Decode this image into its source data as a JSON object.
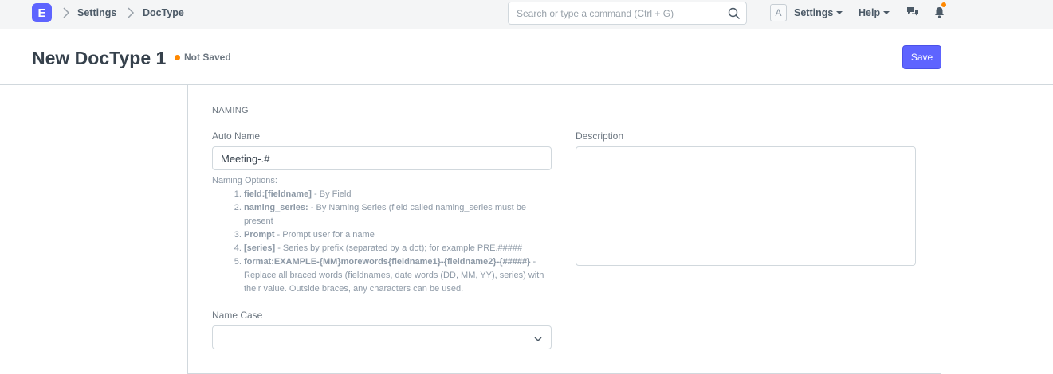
{
  "navbar": {
    "logo_letter": "E",
    "breadcrumbs": [
      "Settings",
      "DocType"
    ],
    "search_placeholder": "Search or type a command (Ctrl + G)",
    "avatar_letter": "A",
    "settings_label": "Settings",
    "help_label": "Help",
    "icons": [
      "chevron-right-icon",
      "search-icon",
      "chat-icon",
      "bell-icon"
    ],
    "notification_color": "#ff8800"
  },
  "page": {
    "title": "New DocType 1",
    "status": "Not Saved",
    "save_label": "Save",
    "accent_color": "#5e64ff"
  },
  "form": {
    "section_title": "NAMING",
    "auto_name": {
      "label": "Auto Name",
      "value": "Meeting-.#"
    },
    "naming_help": {
      "heading": "Naming Options:",
      "options": [
        {
          "key": "field:[fieldname]",
          "text": " - By Field"
        },
        {
          "key": "naming_series:",
          "text": " - By Naming Series (field called naming_series must be present"
        },
        {
          "key": "Prompt",
          "text": " - Prompt user for a name"
        },
        {
          "key": "[series]",
          "text": " - Series by prefix (separated by a dot); for example PRE.#####"
        },
        {
          "key": "format:EXAMPLE-{MM}morewords{fieldname1}-{fieldname2}-{#####}",
          "text": " - Replace all braced words (fieldnames, date words (DD, MM, YY), series) with their value. Outside braces, any characters can be used."
        }
      ]
    },
    "name_case": {
      "label": "Name Case",
      "value": ""
    },
    "description": {
      "label": "Description",
      "value": ""
    }
  }
}
